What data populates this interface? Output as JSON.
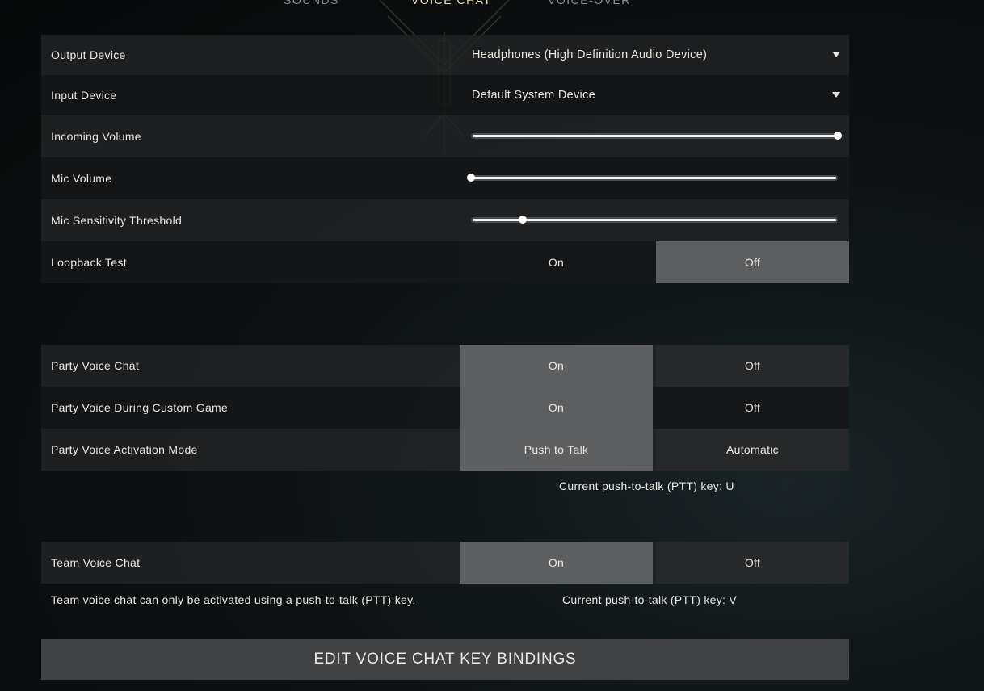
{
  "tabs": [
    {
      "label": "SOUNDS"
    },
    {
      "label": "VOICE CHAT"
    },
    {
      "label": "VOICE-OVER"
    }
  ],
  "audio": {
    "output_device": {
      "label": "Output Device",
      "value": "Headphones (High Definition Audio Device)"
    },
    "input_device": {
      "label": "Input Device",
      "value": "Default System Device"
    },
    "incoming_volume": {
      "label": "Incoming Volume",
      "value_pct": 100
    },
    "mic_volume": {
      "label": "Mic Volume",
      "value_pct": 0
    },
    "mic_sensitivity": {
      "label": "Mic Sensitivity Threshold",
      "value_pct": 14
    },
    "loopback": {
      "label": "Loopback Test",
      "on": "On",
      "off": "Off",
      "selected": "off"
    }
  },
  "party": {
    "voice_chat": {
      "label": "Party Voice Chat",
      "on": "On",
      "off": "Off",
      "selected": "on"
    },
    "custom_game": {
      "label": "Party Voice During Custom Game",
      "on": "On",
      "off": "Off",
      "selected": "on"
    },
    "activation_mode": {
      "label": "Party Voice Activation Mode",
      "left": "Push to Talk",
      "right": "Automatic",
      "selected": "left"
    },
    "ptt_key_text": "Current push-to-talk (PTT) key: U"
  },
  "team": {
    "voice_chat": {
      "label": "Team Voice Chat",
      "on": "On",
      "off": "Off",
      "selected": "on"
    },
    "note": "Team voice chat can only be activated using a push-to-talk (PTT) key.",
    "ptt_key_text": "Current push-to-talk (PTT) key: V"
  },
  "edit_button": "EDIT VOICE CHAT KEY BINDINGS",
  "colors": {
    "accent": "#ede3b0",
    "selected_segment": "#646566",
    "slider": "#f2f2f2"
  }
}
